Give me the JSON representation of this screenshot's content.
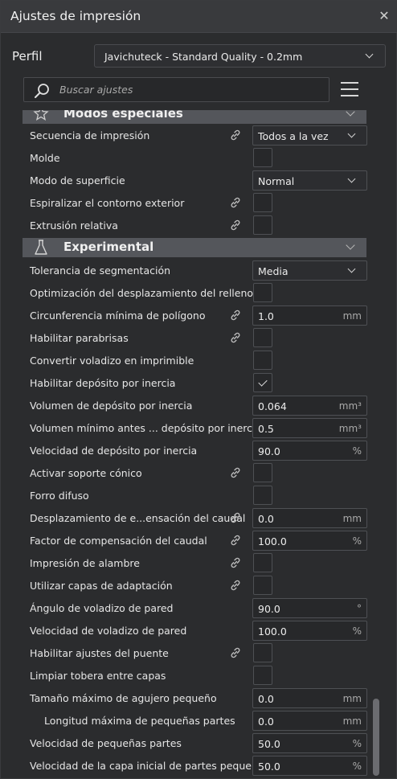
{
  "window": {
    "title": "Ajustes de impresión"
  },
  "profile": {
    "label": "Perfil",
    "value": "Javichuteck - Standard Quality - 0.2mm"
  },
  "search": {
    "placeholder": "Buscar ajustes"
  },
  "categories": [
    {
      "title": "Modos especiales",
      "icon": "special-modes-icon"
    },
    {
      "title": "Experimental",
      "icon": "flask-icon"
    }
  ],
  "settings": [
    {
      "label": "Secuencia de impresión",
      "control": "select",
      "value": "Todos a la vez",
      "link": true
    },
    {
      "label": "Molde",
      "control": "checkbox",
      "checked": false,
      "link": false
    },
    {
      "label": "Modo de superficie",
      "control": "select",
      "value": "Normal",
      "link": false
    },
    {
      "label": "Espiralizar el contorno exterior",
      "control": "checkbox",
      "checked": false,
      "link": true
    },
    {
      "label": "Extrusión relativa",
      "control": "checkbox",
      "checked": false,
      "link": true
    },
    {
      "label": "Tolerancia de segmentación",
      "control": "select",
      "value": "Media",
      "link": false
    },
    {
      "label": "Optimización del desplazamiento del relleno",
      "control": "checkbox",
      "checked": false,
      "link": false
    },
    {
      "label": "Circunferencia mínima de polígono",
      "control": "field",
      "value": "1.0",
      "unit": "mm",
      "link": true
    },
    {
      "label": "Habilitar parabrisas",
      "control": "checkbox",
      "checked": false,
      "link": true
    },
    {
      "label": "Convertir voladizo en imprimible",
      "control": "checkbox",
      "checked": false,
      "link": false
    },
    {
      "label": "Habilitar depósito por inercia",
      "control": "checkbox",
      "checked": true,
      "link": false
    },
    {
      "label": "Volumen de depósito por inercia",
      "control": "field",
      "value": "0.064",
      "unit": "mm³",
      "link": false
    },
    {
      "label": "Volumen mínimo antes ... depósito por inercia",
      "control": "field",
      "value": "0.5",
      "unit": "mm³",
      "link": false
    },
    {
      "label": "Velocidad de depósito por inercia",
      "control": "field",
      "value": "90.0",
      "unit": "%",
      "link": false
    },
    {
      "label": "Activar soporte cónico",
      "control": "checkbox",
      "checked": false,
      "link": true
    },
    {
      "label": "Forro difuso",
      "control": "checkbox",
      "checked": false,
      "link": false
    },
    {
      "label": "Desplazamiento de e...ensación del caudal",
      "control": "field",
      "value": "0.0",
      "unit": "mm",
      "link": true
    },
    {
      "label": "Factor de compensación del caudal",
      "control": "field",
      "value": "100.0",
      "unit": "%",
      "link": true
    },
    {
      "label": "Impresión de alambre",
      "control": "checkbox",
      "checked": false,
      "link": true
    },
    {
      "label": "Utilizar capas de adaptación",
      "control": "checkbox",
      "checked": false,
      "link": true
    },
    {
      "label": "Ángulo de voladizo de pared",
      "control": "field",
      "value": "90.0",
      "unit": "°",
      "link": false
    },
    {
      "label": "Velocidad de voladizo de pared",
      "control": "field",
      "value": "100.0",
      "unit": "%",
      "link": false
    },
    {
      "label": "Habilitar ajustes del puente",
      "control": "checkbox",
      "checked": false,
      "link": true
    },
    {
      "label": "Limpiar tobera entre capas",
      "control": "checkbox",
      "checked": false,
      "link": false
    },
    {
      "label": "Tamaño máximo de agujero pequeño",
      "control": "field",
      "value": "0.0",
      "unit": "mm",
      "link": false
    },
    {
      "label": "Longitud máxima de pequeñas partes",
      "control": "field",
      "value": "0.0",
      "unit": "mm",
      "link": false,
      "indent": true
    },
    {
      "label": "Velocidad de pequeñas partes",
      "control": "field",
      "value": "50.0",
      "unit": "%",
      "link": false
    },
    {
      "label": "Velocidad de la capa inicial de partes pequeñas",
      "control": "field",
      "value": "50.0",
      "unit": "%",
      "link": false
    }
  ]
}
